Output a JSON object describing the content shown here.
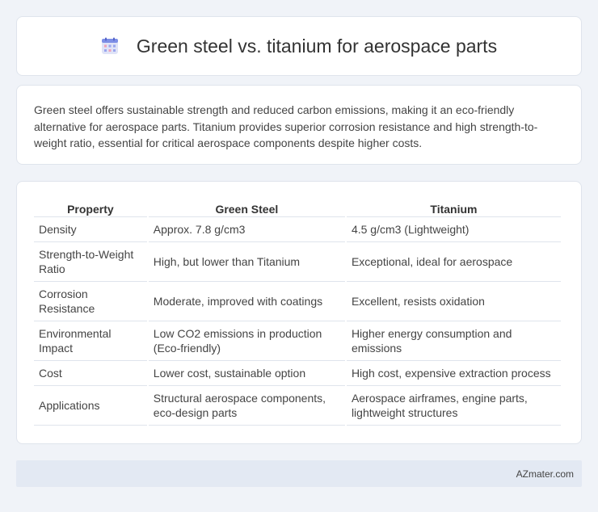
{
  "header": {
    "icon": "calendar-grid-icon",
    "title": "Green steel vs. titanium for aerospace parts"
  },
  "summary": {
    "text": "Green steel offers sustainable strength and reduced carbon emissions, making it an eco-friendly alternative for aerospace parts. Titanium provides superior corrosion resistance and high strength-to-weight ratio, essential for critical aerospace components despite higher costs."
  },
  "table": {
    "headers": [
      "Property",
      "Green Steel",
      "Titanium"
    ],
    "rows": [
      [
        "Density",
        "Approx. 7.8 g/cm3",
        "4.5 g/cm3 (Lightweight)"
      ],
      [
        "Strength-to-Weight Ratio",
        "High, but lower than Titanium",
        "Exceptional, ideal for aerospace"
      ],
      [
        "Corrosion Resistance",
        "Moderate, improved with coatings",
        "Excellent, resists oxidation"
      ],
      [
        "Environmental Impact",
        "Low CO2 emissions in production (Eco-friendly)",
        "Higher energy consumption and emissions"
      ],
      [
        "Cost",
        "Lower cost, sustainable option",
        "High cost, expensive extraction process"
      ],
      [
        "Applications",
        "Structural aerospace components, eco-design parts",
        "Aerospace airframes, engine parts, lightweight structures"
      ]
    ]
  },
  "footer": {
    "text": "AZmater.com"
  },
  "colors": {
    "background": "#f0f3f8",
    "card": "#ffffff",
    "footer": "#e3e9f3"
  }
}
